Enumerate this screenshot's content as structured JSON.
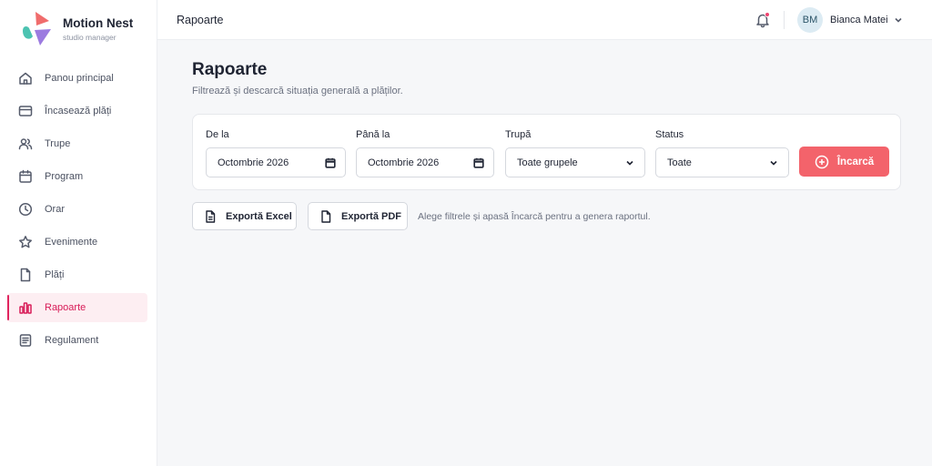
{
  "brand": {
    "name": "Motion Nest",
    "subtitle": "studio manager"
  },
  "sidebar": {
    "items": [
      {
        "label": "Panou principal",
        "icon": "home-icon",
        "active": false
      },
      {
        "label": "Încasează plăți",
        "icon": "wallet-icon",
        "active": false
      },
      {
        "label": "Trupe",
        "icon": "users-icon",
        "active": false
      },
      {
        "label": "Program",
        "icon": "calendar-icon",
        "active": false
      },
      {
        "label": "Orar",
        "icon": "clock-icon",
        "active": false
      },
      {
        "label": "Evenimente",
        "icon": "star-icon",
        "active": false
      },
      {
        "label": "Plăți",
        "icon": "file-icon",
        "active": false
      },
      {
        "label": "Rapoarte",
        "icon": "bar-chart-icon",
        "active": true
      },
      {
        "label": "Regulament",
        "icon": "document-list-icon",
        "active": false
      }
    ]
  },
  "topbar": {
    "title": "Rapoarte",
    "user": {
      "initials": "BM",
      "name": "Bianca Matei"
    }
  },
  "page": {
    "title": "Rapoarte",
    "subtitle": "Filtrează și descarcă situația generală a plăților."
  },
  "filters": {
    "from": {
      "label": "De la",
      "value": "Octombrie 2026"
    },
    "to": {
      "label": "Până la",
      "value": "Octombrie 2026"
    },
    "group": {
      "label": "Trupă",
      "value": "Toate grupele"
    },
    "status": {
      "label": "Status",
      "value": "Toate"
    },
    "load_label": "Încarcă"
  },
  "exports": {
    "excel_label": "Exportă Excel",
    "pdf_label": "Exportă PDF",
    "hint": "Alege filtrele și apasă Încarcă pentru a genera raportul."
  },
  "colors": {
    "accent": "#e0245e",
    "accent_bg": "#fdeef2",
    "button": "#f3636b",
    "notification_dot": "#ef4470",
    "avatar_bg": "#dcebf3"
  }
}
